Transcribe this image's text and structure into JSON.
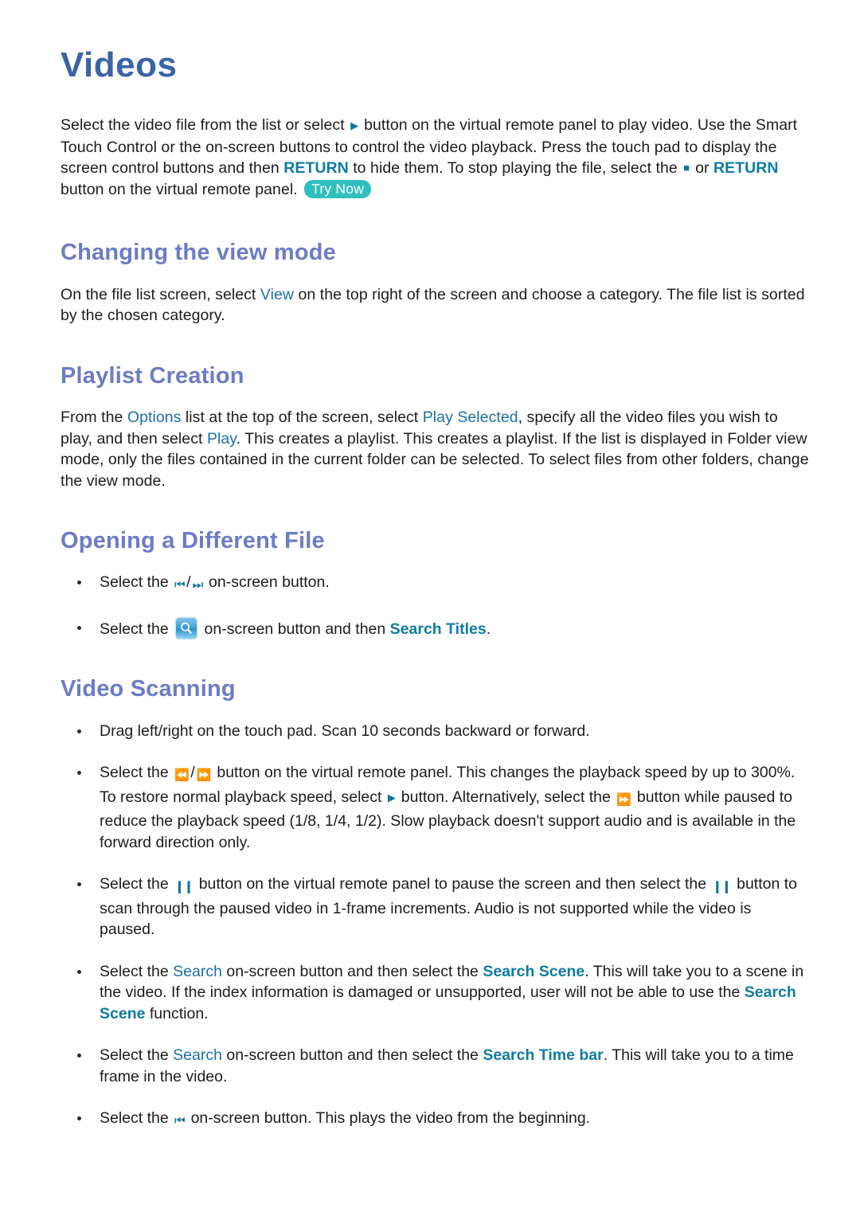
{
  "document": {
    "title": "Videos"
  },
  "intro": {
    "part1": "Select the video file from the list or select ",
    "icon_play": "play-icon",
    "part2": " button on the virtual remote panel to play video. Use the Smart Touch Control or the on-screen buttons to control the video playback. Press the touch pad to display the screen control buttons and then ",
    "return1": "RETURN",
    "part3": " to hide them. To stop playing the file, select the ",
    "icon_stop": "stop-icon",
    "part4": " or ",
    "return2": "RETURN",
    "part5": " button on the virtual remote panel. ",
    "try_now_badge": "Try Now"
  },
  "sections": [
    {
      "heading": "Changing the view mode",
      "paragraph": {
        "part1": "On the file list screen, select ",
        "link1": "View",
        "part2": " on the top right of the screen and choose a category. The file list is sorted by the chosen category."
      }
    },
    {
      "heading": "Playlist Creation",
      "paragraph": {
        "part1": "From the ",
        "link1": "Options",
        "part2": " list at the top of the screen, select ",
        "link2": "Play Selected",
        "part3": ", specify all the video files you wish to play, and then select ",
        "link3": "Play",
        "part4": ". This creates a playlist. This creates a playlist. If the list is displayed in Folder view mode, only the files contained in the current folder can be selected. To select files from other folders, change the view mode."
      }
    },
    {
      "heading": "Opening a Different File",
      "bullets": [
        {
          "part1": "Select the ",
          "icon1": "skip-backward-icon",
          "separator": "/",
          "icon2": "skip-forward-icon",
          "part2": " on-screen button."
        },
        {
          "part1": "Select the ",
          "icon1": "search-magnifier-button-icon",
          "part2": " on-screen button and then ",
          "link1": "Search Titles",
          "part3": "."
        }
      ]
    },
    {
      "heading": "Video Scanning",
      "bullets": [
        {
          "part1": "Drag left/right on the touch pad. Scan 10 seconds backward or forward."
        },
        {
          "part1": "Select the ",
          "icon1": "rewind-icon",
          "separator": "/",
          "icon2": "fast-forward-icon",
          "part2": " button on the virtual remote panel. This changes the playback speed by up to 300%. To restore normal playback speed, select ",
          "icon3": "play-icon",
          "part3": " button. Alternatively, select the ",
          "icon4": "fast-forward-icon",
          "part4": " button while paused to reduce the playback speed (1/8, 1/4, 1/2). Slow playback doesn't support audio and is available in the forward direction only."
        },
        {
          "part1": "Select the ",
          "icon1": "pause-icon",
          "part2": " button on the virtual remote panel to pause the screen and then select the ",
          "icon2": "pause-icon",
          "part3": " button to scan through the paused video in 1-frame increments. Audio is not supported while the video is paused."
        },
        {
          "part1": "Select the ",
          "link1": "Search",
          "part2": " on-screen button and then select the ",
          "link2": "Search Scene",
          "part3": ". This will take you to a scene in the video. If the index information is damaged or unsupported, user will not be able to use the ",
          "link3": "Search Scene",
          "part4": " function."
        },
        {
          "part1": "Select the ",
          "link1": "Search",
          "part2": " on-screen button and then select the ",
          "link2": "Search Time bar",
          "part3": ". This will take you to a time frame in the video."
        },
        {
          "part1": "Select the ",
          "icon1": "skip-backward-icon",
          "part2": " on-screen button. This plays the video from the beginning."
        }
      ]
    }
  ],
  "colors": {
    "title_blue": "#3a63a8",
    "heading_periwinkle": "#6b7cc4",
    "link_teal_blue": "#0f7ba5",
    "try_now_teal": "#30bfbf",
    "body_text": "#1c1c1c"
  }
}
